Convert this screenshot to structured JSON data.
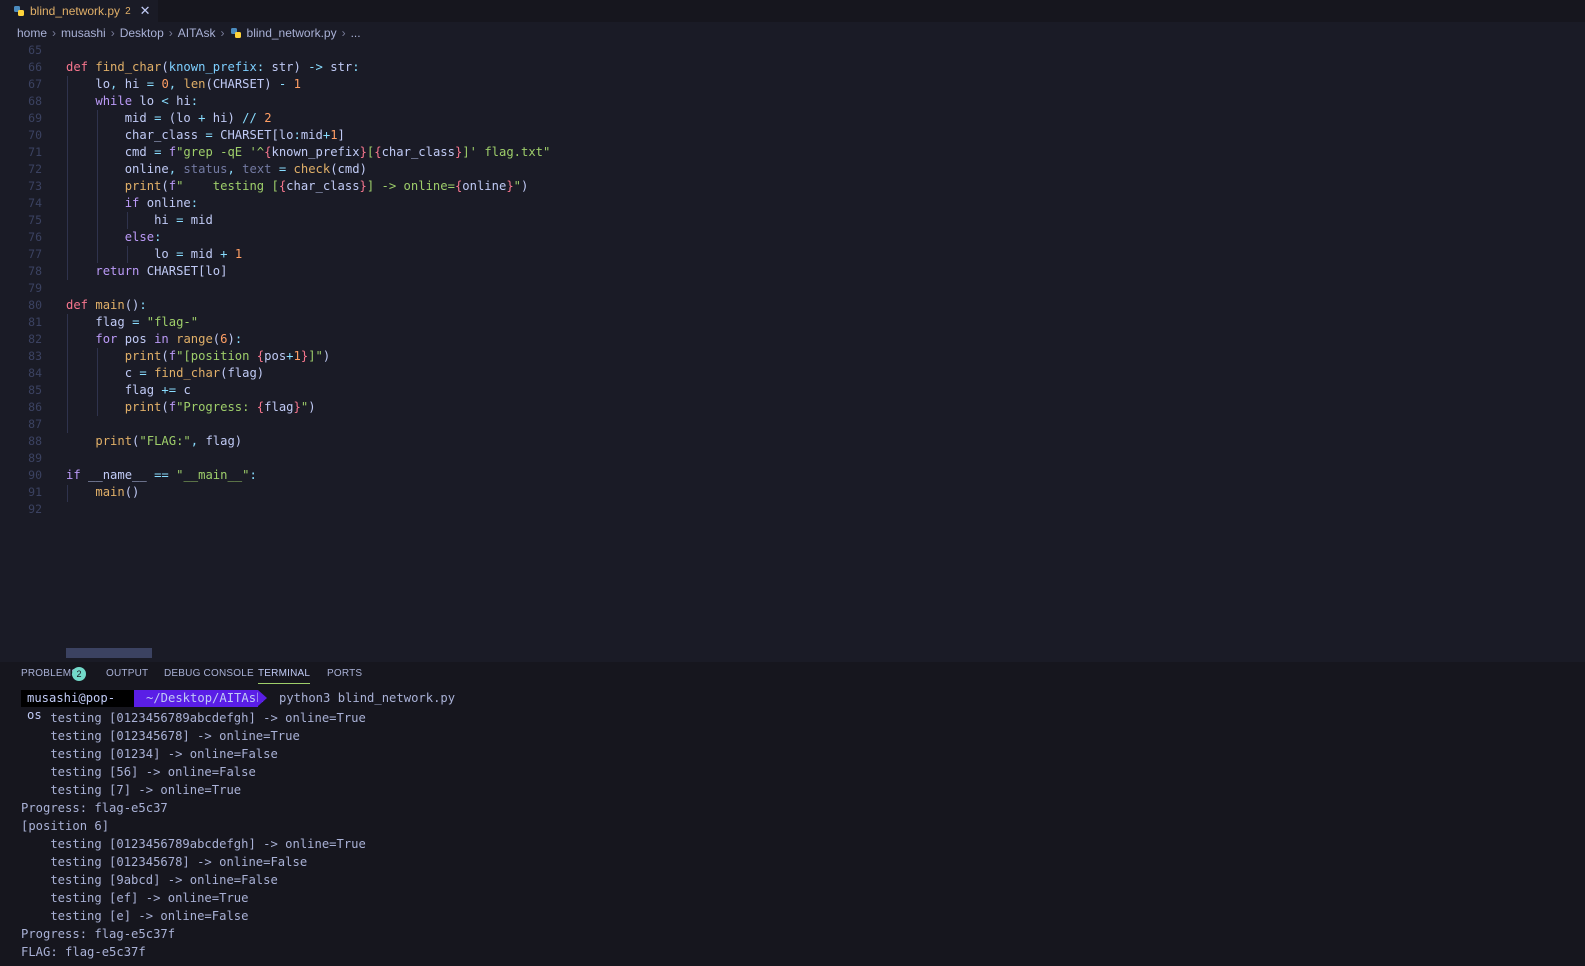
{
  "tab": {
    "filename": "blind_network.py",
    "problem_count": "2",
    "close_glyph": "✕"
  },
  "breadcrumb": {
    "items": [
      "home",
      "musashi",
      "Desktop",
      "AITAsk",
      "blind_network.py",
      "..."
    ]
  },
  "editor": {
    "line_numbers": [
      "65",
      "66",
      "67",
      "68",
      "69",
      "70",
      "71",
      "72",
      "73",
      "74",
      "75",
      "76",
      "77",
      "78",
      "79",
      "80",
      "81",
      "82",
      "83",
      "84",
      "85",
      "86",
      "87",
      "88",
      "89",
      "90",
      "91",
      "92"
    ]
  },
  "panel": {
    "tabs": [
      "PROBLEMS",
      "OUTPUT",
      "DEBUG CONSOLE",
      "TERMINAL",
      "PORTS"
    ],
    "problems_badge": "2",
    "active_tab": "TERMINAL"
  },
  "terminal": {
    "prompt_user": "musashi@pop-os",
    "prompt_path": "~/Desktop/AITAsk",
    "command": "python3 blind_network.py",
    "output": [
      "    testing [0123456789abcdefgh] -> online=True",
      "    testing [012345678] -> online=True",
      "    testing [01234] -> online=False",
      "    testing [56] -> online=False",
      "    testing [7] -> online=True",
      "Progress: flag-e5c37",
      "[position 6]",
      "    testing [0123456789abcdefgh] -> online=True",
      "    testing [012345678] -> online=False",
      "    testing [9abcd] -> online=False",
      "    testing [ef] -> online=True",
      "    testing [e] -> online=False",
      "Progress: flag-e5c37f",
      "FLAG: flag-e5c37f"
    ]
  },
  "colors": {
    "background": "#1a1b26",
    "panel": "#16161e",
    "accent": "#5a1ee6",
    "badge": "#73daca"
  }
}
